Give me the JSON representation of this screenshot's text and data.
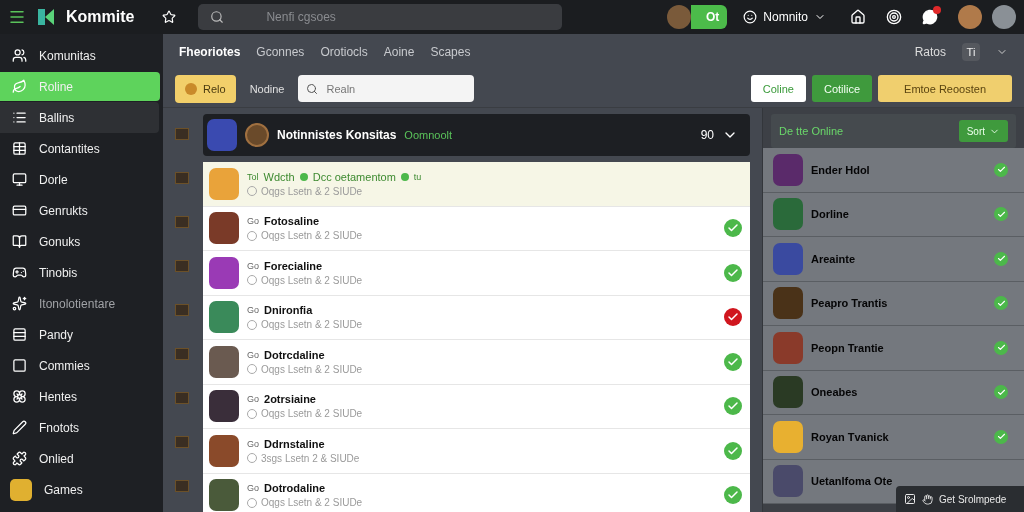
{
  "topbar": {
    "brand": "Kommite",
    "search": {
      "placeholder": "Nenfi cgsoes"
    },
    "status_pill": {
      "label": "Ot",
      "online": true
    },
    "user": {
      "name": "Nomnito"
    },
    "notifications": {
      "unread": true
    }
  },
  "sidebar": {
    "items": [
      {
        "label": "Komunitas",
        "selected": false,
        "hovered": false,
        "disabled": false
      },
      {
        "label": "Roline",
        "selected": true,
        "hovered": false,
        "disabled": false
      },
      {
        "label": "Ballins",
        "selected": false,
        "hovered": true,
        "disabled": false
      },
      {
        "label": "Contantites",
        "selected": false,
        "hovered": false,
        "disabled": false
      },
      {
        "label": "Dorle",
        "selected": false,
        "hovered": false,
        "disabled": false
      },
      {
        "label": "Genrukts",
        "selected": false,
        "hovered": false,
        "disabled": false
      },
      {
        "label": "Gonuks",
        "selected": false,
        "hovered": false,
        "disabled": false
      },
      {
        "label": "Tinobis",
        "selected": false,
        "hovered": false,
        "disabled": false
      },
      {
        "label": "Itonolotientare",
        "selected": false,
        "hovered": false,
        "disabled": true
      },
      {
        "label": "Pandy",
        "selected": false,
        "hovered": false,
        "disabled": false
      },
      {
        "label": "Commies",
        "selected": false,
        "hovered": false,
        "disabled": false
      },
      {
        "label": "Hentes",
        "selected": false,
        "hovered": false,
        "disabled": false
      },
      {
        "label": "Fnotots",
        "selected": false,
        "hovered": false,
        "disabled": false
      },
      {
        "label": "Onlied",
        "selected": false,
        "hovered": false,
        "disabled": false
      },
      {
        "label": "Games",
        "selected": false,
        "hovered": false,
        "disabled": false
      }
    ]
  },
  "tabs": [
    {
      "label": "Fheoriotes",
      "selected": true
    },
    {
      "label": "Gconnes",
      "selected": false
    },
    {
      "label": "Orotiocls",
      "selected": false
    },
    {
      "label": "Aoine",
      "selected": false
    },
    {
      "label": "Scapes",
      "selected": false
    }
  ],
  "view_switch": {
    "label": "Ratos",
    "button": "Ti"
  },
  "filters": {
    "chip": "Relo",
    "label": "Nodine",
    "search": {
      "placeholder": "Realn"
    },
    "buttons": [
      {
        "label": "Coline",
        "kind": "outline"
      },
      {
        "label": "Cotilice",
        "kind": "green"
      },
      {
        "label": "Emtoe Reoosten",
        "kind": "yellow"
      }
    ]
  },
  "group": {
    "title": "Notinnistes Konsitas",
    "badge": "Oomnoolt",
    "count": "90"
  },
  "rows": [
    {
      "prefix": "Tol",
      "name": "Wdcth",
      "tag": "Dcc oetamentom",
      "suffix": "tu",
      "subtitle": "Oqgs Lsetn & 2 SIUDe",
      "selected": true,
      "checked": false
    },
    {
      "prefix": "Go",
      "name": "Fotosaline",
      "subtitle": "Oqgs Lsetn & 2 SIUDe",
      "selected": false,
      "checked": true,
      "error": false
    },
    {
      "prefix": "Go",
      "name": "Forecialine",
      "subtitle": "Oqgs Lsetn & 2 SIUDe",
      "selected": false,
      "checked": true,
      "error": false
    },
    {
      "prefix": "Go",
      "name": "Dnironfia",
      "subtitle": "Oqgs Lsetn & 2 SIUDe",
      "selected": false,
      "checked": true,
      "error": true
    },
    {
      "prefix": "Go",
      "name": "Dotrcdaline",
      "subtitle": "Oqgs Lsetn & 2 SIUDe",
      "selected": false,
      "checked": true,
      "error": false
    },
    {
      "prefix": "Go",
      "name": "2otrsiaine",
      "subtitle": "Oqgs Lsetn & 2 SIUDe",
      "selected": false,
      "checked": true,
      "error": false
    },
    {
      "prefix": "Go",
      "name": "Ddrnstaline",
      "subtitle": "3sgs Lsetn 2 & SIUDe",
      "selected": false,
      "checked": true,
      "error": false
    },
    {
      "prefix": "Go",
      "name": "Dotrodaline",
      "subtitle": "Oqgs Lsetn & 2 SIUDe",
      "selected": false,
      "checked": true,
      "error": false
    }
  ],
  "online": {
    "title": "De tte Online",
    "sort": "Sort",
    "items": [
      {
        "name": "Ender Hdol",
        "checked": true
      },
      {
        "name": "Dorline",
        "checked": true
      },
      {
        "name": "Areainte",
        "checked": true
      },
      {
        "name": "Peapro Trantis",
        "checked": true
      },
      {
        "name": "Peopn Trantie",
        "checked": true
      },
      {
        "name": "Oneabes",
        "checked": true
      },
      {
        "name": "Royan Tvanick",
        "checked": true
      },
      {
        "name": "Uetanlfoma Ote",
        "checked": false
      }
    ]
  },
  "toast": {
    "label": "Get Srolmpede"
  }
}
